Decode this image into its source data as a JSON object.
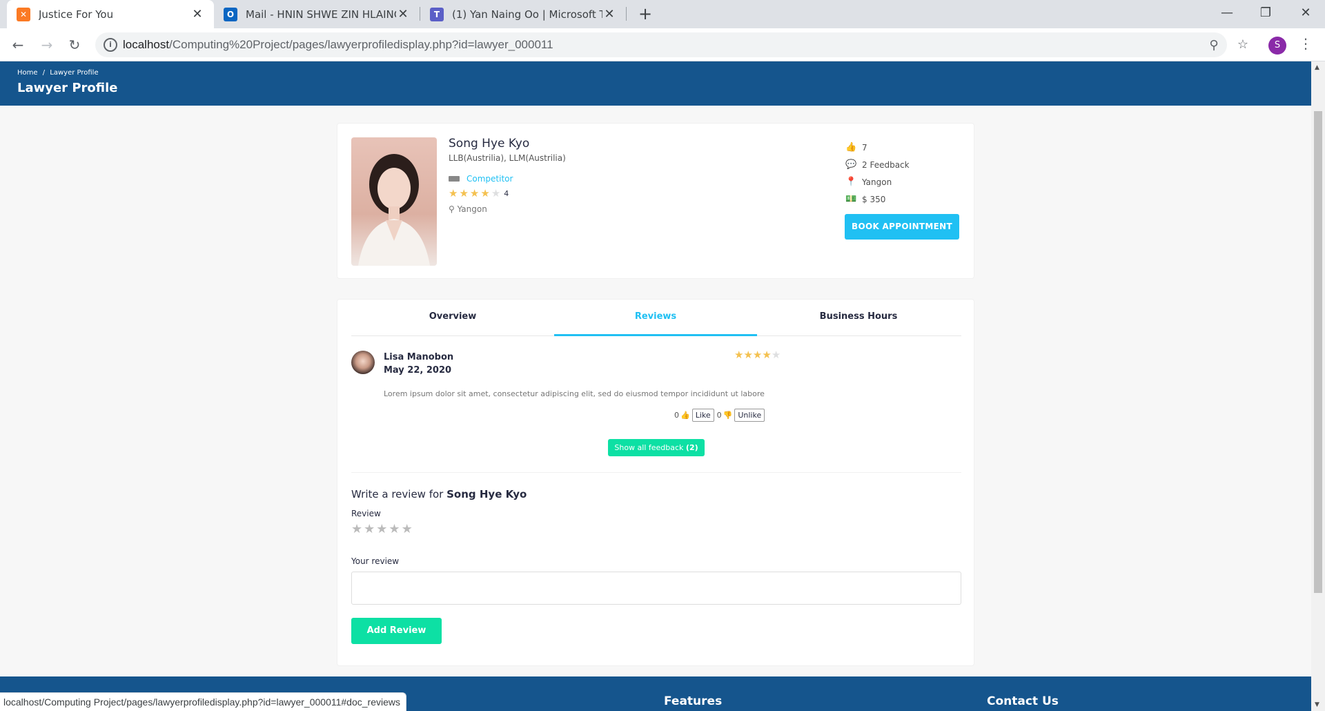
{
  "browser": {
    "tabs": [
      {
        "title": "Justice For You",
        "favicon": "xampp-icon",
        "active": true
      },
      {
        "title": "Mail - HNIN SHWE ZIN HLAING -",
        "favicon": "outlook-icon",
        "active": false
      },
      {
        "title": "(1) Yan Naing Oo | Microsoft Tea",
        "favicon": "teams-icon",
        "active": false
      }
    ],
    "url_host": "localhost",
    "url_path": "/Computing%20Project/pages/lawyerprofiledisplay.php?id=lawyer_000011",
    "profile_initial": "S",
    "status_url": "localhost/Computing Project/pages/lawyerprofiledisplay.php?id=lawyer_000011#doc_reviews"
  },
  "header": {
    "breadcrumb": [
      "Home",
      "/",
      "Lawyer Profile"
    ],
    "title": "Lawyer Profile"
  },
  "lawyer": {
    "name": "Song Hye Kyo",
    "degree": "LLB(Austrilia), LLM(Austrilia)",
    "specialty": "Competitor",
    "rating": 4,
    "rating_count": "4",
    "location": "Yangon",
    "stats": {
      "likes": "7",
      "feedback": "2 Feedback",
      "location": "Yangon",
      "fee": "$ 350"
    },
    "book_label": "BOOK APPOINTMENT"
  },
  "tabs": [
    "Overview",
    "Reviews",
    "Business Hours"
  ],
  "active_tab": "Reviews",
  "review": {
    "name": "Lisa Manobon",
    "date": "May 22, 2020",
    "rating": 4,
    "text": "Lorem ipsum dolor sit amet, consectetur adipiscing elit, sed do eiusmod tempor incididunt ut labore",
    "like_count": "0",
    "like_label": "Like",
    "unlike_count": "0",
    "unlike_label": "Unlike"
  },
  "show_all_label": "Show all feedback",
  "show_all_count": "(2)",
  "write_review": {
    "prefix": "Write a review for",
    "name": "Song Hye Kyo",
    "review_label": "Review",
    "your_review_label": "Your review",
    "textarea_value": "",
    "submit_label": "Add Review"
  },
  "footer": {
    "features": "Features",
    "contact": "Contact Us"
  },
  "colors": {
    "brand_blue": "#15558d",
    "accent": "#20c0f3",
    "green": "#0de0a4",
    "star": "#f4c150"
  }
}
